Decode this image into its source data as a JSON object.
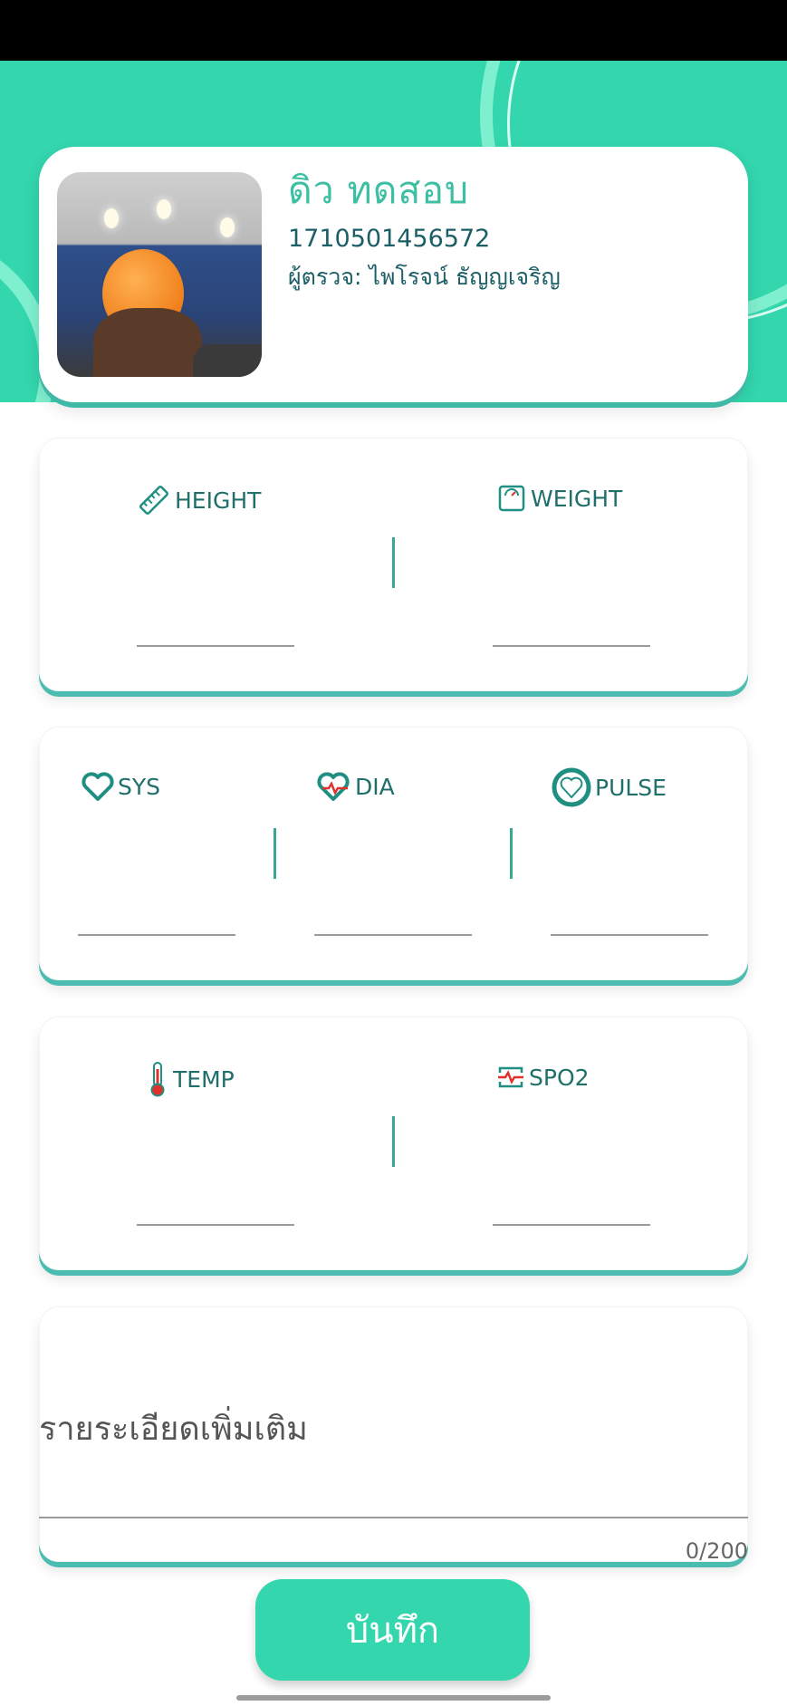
{
  "profile": {
    "name": "ดิว   ทดสอบ",
    "id": "1710501456572",
    "examiner": "ผู้ตรวจ: ไพโรจน์ ธัญญเจริญ"
  },
  "body_metrics": {
    "height": {
      "label": "HEIGHT",
      "icon": "ruler-icon",
      "value": ""
    },
    "weight": {
      "label": "WEIGHT",
      "icon": "scale-icon",
      "value": ""
    }
  },
  "blood_pressure": {
    "sys": {
      "label": "SYS",
      "icon": "heart-outline-icon",
      "value": ""
    },
    "dia": {
      "label": "DIA",
      "icon": "heart-pulse-icon",
      "value": ""
    },
    "pulse": {
      "label": "PULSE",
      "icon": "heart-filled-icon",
      "value": ""
    }
  },
  "vitals": {
    "temp": {
      "label": "TEMP",
      "icon": "thermometer-icon",
      "value": ""
    },
    "spo2": {
      "label": "SPO2",
      "icon": "monitor-pulse-icon",
      "value": ""
    }
  },
  "notes": {
    "placeholder": "รายระเอียดเพิ่มเติม",
    "counter": "0/200"
  },
  "actions": {
    "save_label": "บันทึก"
  },
  "colors": {
    "accent": "#33d6ad",
    "text": "#1f6f6a",
    "icon_red": "#e0312c"
  }
}
